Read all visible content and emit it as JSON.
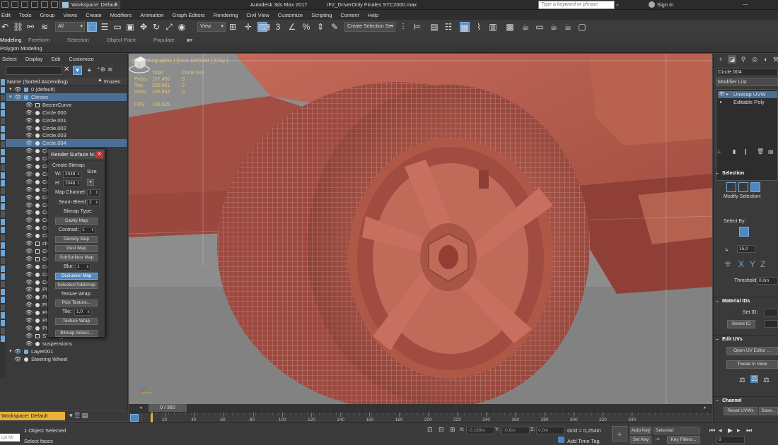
{
  "titlebar": {
    "workspace": "Workspace: Default",
    "app_title": "Autodesk 3ds Max 2017",
    "file_title": "rF2_DriverOnly Finales STC2000.max",
    "search_placeholder": "Type a keyword or phrase",
    "sign_in": "Sign In"
  },
  "menu": [
    "Edit",
    "Tools",
    "Group",
    "Views",
    "Create",
    "Modifiers",
    "Animation",
    "Graph Editors",
    "Rendering",
    "Civil View",
    "Customize",
    "Scripting",
    "Content",
    "Help"
  ],
  "toolbar": {
    "filter_all": "All",
    "ref_coord": "View",
    "selection_set": "Create Selection Se"
  },
  "ribbon": {
    "tabs": [
      "Modeling",
      "Freeform",
      "Selection",
      "Object Paint",
      "Populate"
    ],
    "active_panel": "Polygon Modeling"
  },
  "explorer": {
    "menu": [
      "Select",
      "Display",
      "Edit",
      "Customize"
    ],
    "col_name": "Name (Sorted Ascending)",
    "col_frozen": "Frozen",
    "items": [
      {
        "label": "0 (default)",
        "kind": "layer",
        "indent": 0
      },
      {
        "label": "Citroen",
        "kind": "layer",
        "indent": 0,
        "selected": true
      },
      {
        "label": "BezierCurve",
        "kind": "spline",
        "indent": 1
      },
      {
        "label": "Circle.000",
        "kind": "mesh",
        "indent": 1
      },
      {
        "label": "Circle.001",
        "kind": "mesh",
        "indent": 1
      },
      {
        "label": "Circle.002",
        "kind": "mesh",
        "indent": 1
      },
      {
        "label": "Circle.003",
        "kind": "mesh",
        "indent": 1
      },
      {
        "label": "Circle.004",
        "kind": "mesh",
        "indent": 1,
        "selected": true
      },
      {
        "label": "Circle",
        "kind": "mesh",
        "indent": 1
      },
      {
        "label": "Circle",
        "kind": "mesh",
        "indent": 1
      },
      {
        "label": "Circle",
        "kind": "mesh",
        "indent": 1
      },
      {
        "label": "Circle",
        "kind": "mesh",
        "indent": 1
      },
      {
        "label": "Circle",
        "kind": "mesh",
        "indent": 1
      },
      {
        "label": "Circle",
        "kind": "mesh",
        "indent": 1
      },
      {
        "label": "Circle",
        "kind": "mesh",
        "indent": 1
      },
      {
        "label": "Circle",
        "kind": "mesh",
        "indent": 1
      },
      {
        "label": "Circle",
        "kind": "mesh",
        "indent": 1
      },
      {
        "label": "Circle",
        "kind": "mesh",
        "indent": 1
      },
      {
        "label": "Circle",
        "kind": "mesh",
        "indent": 1
      },
      {
        "label": "Circle",
        "kind": "mesh",
        "indent": 1
      },
      {
        "label": "citroe",
        "kind": "spline",
        "indent": 1
      },
      {
        "label": "COCH",
        "kind": "spline",
        "indent": 1
      },
      {
        "label": "COCH",
        "kind": "spline",
        "indent": 1
      },
      {
        "label": "Cube",
        "kind": "mesh",
        "indent": 1
      },
      {
        "label": "Cube",
        "kind": "mesh",
        "indent": 1
      },
      {
        "label": "Cube",
        "kind": "mesh",
        "indent": 1
      },
      {
        "label": "Plane",
        "kind": "mesh",
        "indent": 1
      },
      {
        "label": "Plane",
        "kind": "mesh",
        "indent": 1
      },
      {
        "label": "Plane",
        "kind": "mesh",
        "indent": 1
      },
      {
        "label": "Plane",
        "kind": "mesh",
        "indent": 1
      },
      {
        "label": "Plane",
        "kind": "mesh",
        "indent": 1
      },
      {
        "label": "Plane.019",
        "kind": "mesh",
        "indent": 1
      },
      {
        "label": "STEER_HR",
        "kind": "spline",
        "indent": 1
      },
      {
        "label": "suspensions",
        "kind": "mesh",
        "indent": 1
      },
      {
        "label": "Layer001",
        "kind": "layer",
        "indent": 0
      },
      {
        "label": "Steering Wheel",
        "kind": "plain",
        "indent": 0
      }
    ]
  },
  "workspace_bar": "Workspace: Default",
  "viewport": {
    "label": "[+] [Orthographic ] [User Defined ] [Clay ]",
    "stats": {
      "header_total": "Total",
      "header_sel": "Circle.004",
      "rows": [
        {
          "k": "Polys:",
          "total": "107.460",
          "sel": "0"
        },
        {
          "k": "Tris:",
          "total": "200.881",
          "sel": "0"
        },
        {
          "k": "Verts:",
          "total": "106.853",
          "sel": "0"
        }
      ],
      "fps_label": "FPS:",
      "fps": "146,625"
    },
    "clay_color": "#b2574a"
  },
  "render_dialog": {
    "title": "Render Surface M...",
    "create_bitmap": "Create Bitmap:",
    "w_label": "W:",
    "w_value": "2048",
    "h_label": "H:",
    "h_value": "2048",
    "size_label": "Size",
    "map_channel_label": "Map Channel:",
    "map_channel": "1",
    "seam_bleed_label": "Seam Bleed:",
    "seam_bleed": "2",
    "bitmap_type": "Bitmap Type:",
    "cavity": "Cavity Map",
    "contrast_label": "Contrast:",
    "contrast": "1",
    "density": "Density Map",
    "dust": "Dust Map",
    "subsurface": "SubSurface Map",
    "blur_label": "Blur:",
    "blur": "1",
    "occlusion": "Occlusion Map",
    "selection_to_bitmap": "SelectionToBitmap",
    "texture_wrap_label": "Texture Wrap:",
    "pick_texture": "Pick Texture...",
    "tile_label": "Tile:",
    "tile": "1,0",
    "texture_wrap_btn": "Texture Wrap",
    "bitmap_select": "Bitmap Select..."
  },
  "cmdpanel": {
    "object_name": "Circle.004",
    "modifier_list": "Modifier List",
    "stack": [
      "Unwrap UVW",
      "Editable Poly"
    ],
    "selection_title": "Selection",
    "modify_selection": "Modify Selection:",
    "select_by": "Select By:",
    "angle": "15,0",
    "xyz": [
      "X",
      "Y",
      "Z"
    ],
    "threshold_label": "Threshold:",
    "threshold": "0,0m",
    "material_ids_title": "Material IDs",
    "set_id": "Set ID:",
    "select_id": "Select ID",
    "edit_uvs_title": "Edit UVs",
    "open_uv_editor": "Open UV Editor ...",
    "tweak_in_view": "Tweak In View",
    "channel_title": "Channel",
    "reset_uvws": "Reset UVWs",
    "save": "Save..."
  },
  "timeline": {
    "thumb": "0 / 360",
    "ticks": [
      "20",
      "40",
      "60",
      "80",
      "100",
      "120",
      "140",
      "160",
      "180",
      "200",
      "220",
      "240",
      "260",
      "280",
      "300",
      "320",
      "340"
    ]
  },
  "status": {
    "script_placeholder": "Lpt Mi",
    "line1": "1 Object Selected",
    "line2": "Select faces",
    "x_label": "X:",
    "x_val": "-0,189m",
    "y_label": "Y:",
    "y_val": "-0,6m",
    "z_label": "Z:",
    "z_val": "0,0m",
    "grid": "Grid = 0,254m",
    "add_time_tag": "Add Time Tag",
    "auto_key": "Auto Key",
    "set_key": "Set Key",
    "selected": "Selected",
    "key_filters": "Key Filters...",
    "frame": "0"
  }
}
